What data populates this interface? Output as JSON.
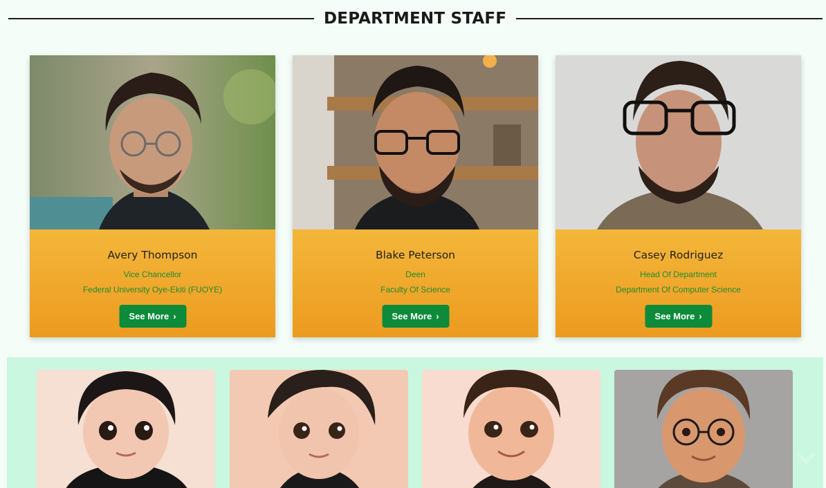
{
  "section": {
    "title": "DEPARTMENT STAFF"
  },
  "staff": [
    {
      "name": "Avery Thompson",
      "role": "Vice Chancellor",
      "organization": "Federal University Oye-Ekiti (FUOYE)",
      "button_label": "See More",
      "button_icon": "chevron-right-icon"
    },
    {
      "name": "Blake Peterson",
      "role": "Deen",
      "organization": "Faculty Of Science",
      "button_label": "See More",
      "button_icon": "chevron-right-icon"
    },
    {
      "name": "Casey Rodriguez",
      "role": "Head Of Department",
      "organization": "Department Of Computer Science",
      "button_label": "See More",
      "button_icon": "chevron-right-icon"
    }
  ],
  "avatars": [
    {
      "style": "cartoon boy, black hoodie"
    },
    {
      "style": "cartoon boy, swept hair, turtleneck"
    },
    {
      "style": "cartoon boy, short hair, necklace"
    },
    {
      "style": "cartoon boy, round glasses"
    }
  ],
  "colors": {
    "page_background": "#f5fdf8",
    "card_info": "#efa62a",
    "button": "#0d8a3a",
    "role_text": "#1f8a2e",
    "band": "#c9f7df"
  }
}
